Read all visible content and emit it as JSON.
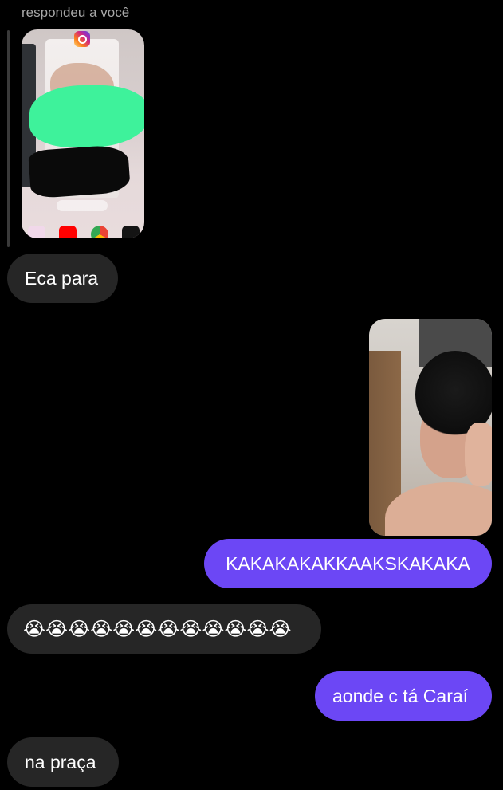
{
  "reply_header": {
    "label": "respondeu a você"
  },
  "story_reply": {
    "icon": "instagram-icon",
    "close_all_label": "Fechar tudo",
    "apps": [
      "app-icon",
      "youtube-icon",
      "chrome-icon",
      "netflix-icon"
    ]
  },
  "messages": [
    {
      "direction": "incoming",
      "text": "Eca para"
    },
    {
      "direction": "outgoing",
      "type": "photo"
    },
    {
      "direction": "outgoing",
      "text": "KAKAKAKAKKAAKSKAKAKA"
    },
    {
      "direction": "incoming",
      "text": "😭😭😭😭😭😭😭😭😭😭😭😭"
    },
    {
      "direction": "outgoing",
      "text": "aonde c tá Caraí"
    },
    {
      "direction": "incoming",
      "text": "na praça"
    }
  ],
  "colors": {
    "background": "#000000",
    "incoming_bubble": "#262626",
    "outgoing_bubble": "#6c47f5",
    "muted_text": "#a8a8a8"
  }
}
